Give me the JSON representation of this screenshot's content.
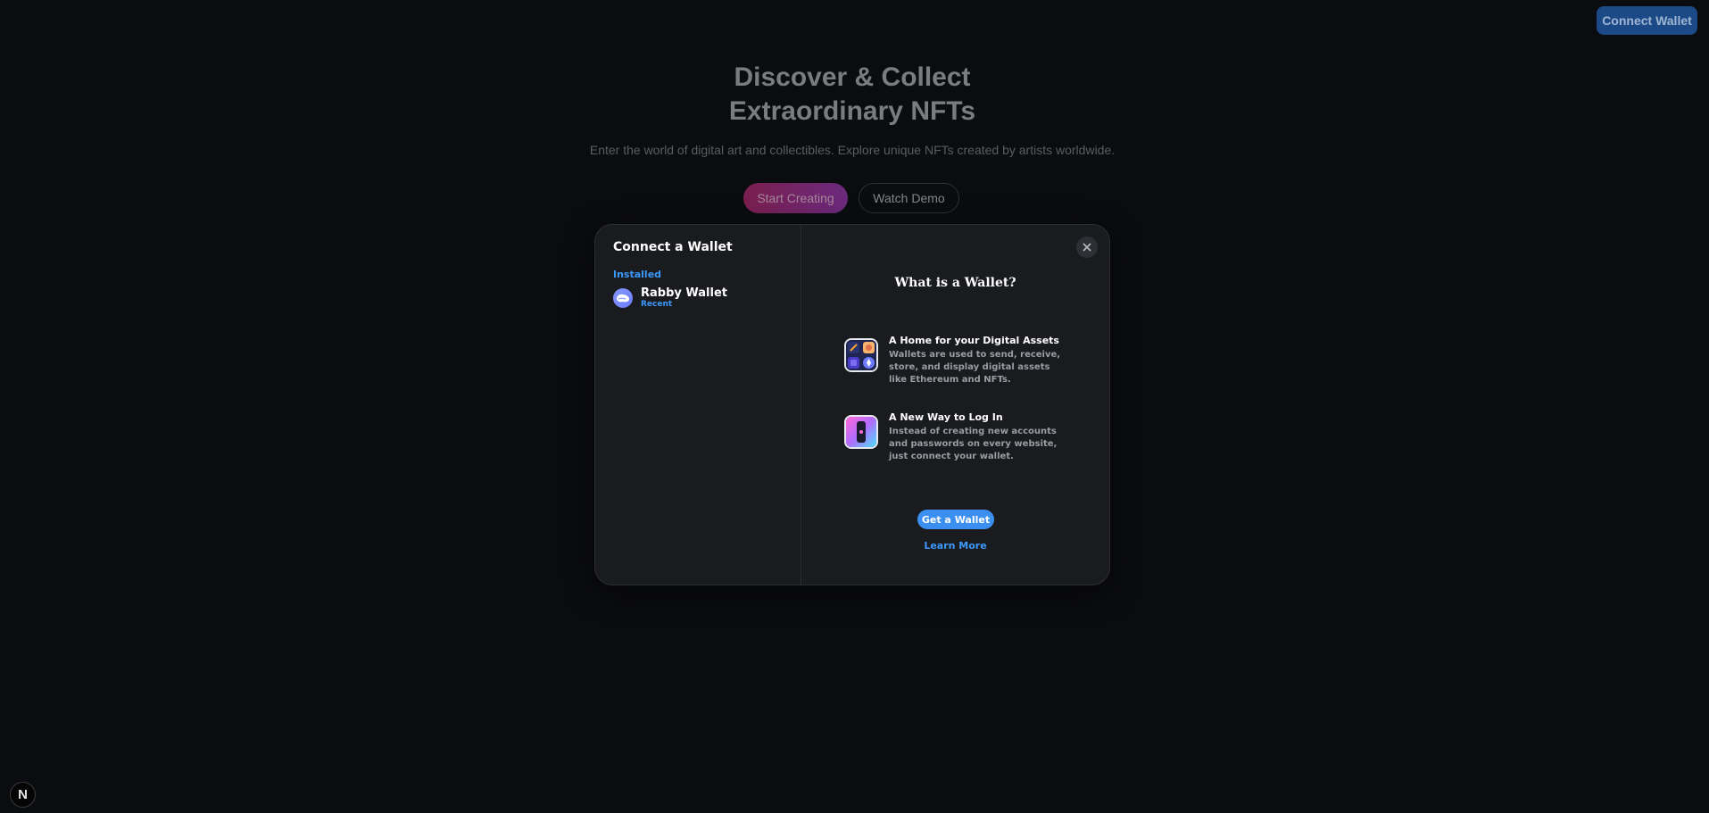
{
  "header": {
    "connect_wallet_label": "Connect Wallet"
  },
  "hero": {
    "title_line1": "Discover & Collect",
    "title_line2": "Extraordinary NFTs",
    "subtitle": "Enter the world of digital art and collectibles. Explore unique NFTs created by artists worldwide.",
    "start_creating_label": "Start Creating",
    "watch_demo_label": "Watch Demo"
  },
  "badge": {
    "letter": "N"
  },
  "modal": {
    "title": "Connect a Wallet",
    "installed_label": "Installed",
    "wallets": [
      {
        "name": "Rabby Wallet",
        "tag": "Recent",
        "icon": "rabby-icon"
      }
    ],
    "info_title": "What is a Wallet?",
    "features": [
      {
        "title": "A Home for your Digital Assets",
        "description": "Wallets are used to send, receive, store, and display digital assets like Ethereum and NFTs.",
        "icon": "digital-assets-icon"
      },
      {
        "title": "A New Way to Log In",
        "description": "Instead of creating new accounts and passwords on every website, just connect your wallet.",
        "icon": "login-icon"
      }
    ],
    "get_wallet_label": "Get a Wallet",
    "learn_more_label": "Learn More"
  },
  "colors": {
    "accent": "#3b99fc",
    "modal_bg": "#1a1b1f",
    "page_bg": "#0b0c0f"
  }
}
